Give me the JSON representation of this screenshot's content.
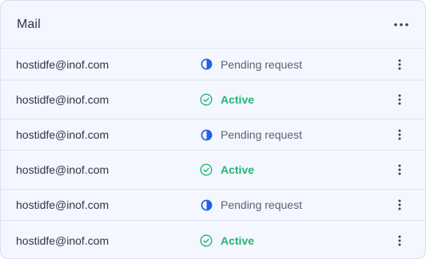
{
  "header": {
    "title": "Mail"
  },
  "colors": {
    "pending": "#2361e6",
    "active": "#22b573"
  },
  "rows": [
    {
      "email": "hostidfe@inof.com",
      "status": "Pending request",
      "icon": "half-circle-icon"
    },
    {
      "email": "hostidfe@inof.com",
      "status": "Active",
      "icon": "check-circle-icon"
    },
    {
      "email": "hostidfe@inof.com",
      "status": "Pending request",
      "icon": "half-circle-icon"
    },
    {
      "email": "hostidfe@inof.com",
      "status": "Active",
      "icon": "check-circle-icon"
    },
    {
      "email": "hostidfe@inof.com",
      "status": "Pending request",
      "icon": "half-circle-icon"
    },
    {
      "email": "hostidfe@inof.com",
      "status": "Active",
      "icon": "check-circle-icon"
    }
  ]
}
